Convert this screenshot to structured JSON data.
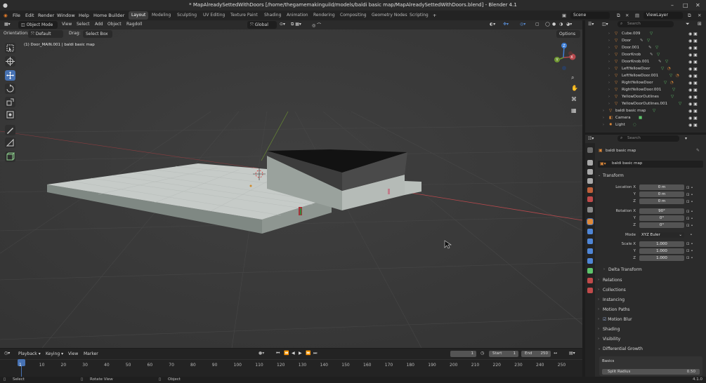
{
  "window": {
    "title": "* MapAlreadySettedWithDoors [/home/thegamemakinguild/models/baldi basic map/MapAlreadySettedWithDoors.blend] - Blender 4.1"
  },
  "menu": [
    "File",
    "Edit",
    "Render",
    "Window",
    "Help",
    "Home Builder"
  ],
  "workspaces": [
    "Layout",
    "Modeling",
    "Sculpting",
    "UV Editing",
    "Texture Paint",
    "Shading",
    "Animation",
    "Rendering",
    "Compositing",
    "Geometry Nodes",
    "Scripting"
  ],
  "active_workspace": "Layout",
  "scene": "Scene",
  "view_layer": "ViewLayer",
  "viewport": {
    "mode": "Object Mode",
    "menus": [
      "View",
      "Select",
      "Add",
      "Object",
      "Ragdoll"
    ],
    "orientation_label": "Orientation:",
    "orientation": "Default",
    "drag_label": "Drag:",
    "drag": "Select Box",
    "transform_orientation": "Global",
    "options": "Options",
    "info": "(1) Door_MAIN.001 | baldi basic map"
  },
  "outliner": {
    "search_placeholder": "Search",
    "items": [
      "Cube.009",
      "Door",
      "Door.001",
      "DoorKnob",
      "DoorKnob.001",
      "LeftYellowDoor",
      "LeftYellowDoor.001",
      "RightYellowDoor",
      "RightYellowDoor.001",
      "YellowDoorOutlines",
      "YellowDoorOutlines.001",
      "baldi basic map",
      "Camera",
      "Light"
    ]
  },
  "properties": {
    "search_placeholder": "Search",
    "object_name": "baldi basic map",
    "data_name": "baldi basic map",
    "transform_title": "Transform",
    "location_label": "Location X",
    "location": [
      "0 m",
      "0 m",
      "0 m"
    ],
    "rotation_label": "Rotation X",
    "rotation": [
      "90°",
      "0°",
      "0°"
    ],
    "mode_label": "Mode",
    "mode": "XYZ Euler",
    "scale_label": "Scale X",
    "scale": [
      "1.000",
      "1.000",
      "1.000"
    ],
    "axis_y": "Y",
    "axis_z": "Z",
    "delta_transform": "Delta Transform",
    "panels": [
      "Relations",
      "Collections",
      "Instancing",
      "Motion Paths",
      "Motion Blur",
      "Shading",
      "Visibility",
      "Differential Growth"
    ],
    "basics": "Basics",
    "split_radius_label": "Split Radius",
    "split_radius": "0.50"
  },
  "timeline": {
    "menus": [
      "Playback",
      "Keying",
      "View",
      "Marker"
    ],
    "current_frame": "1",
    "start_label": "Start",
    "start": "1",
    "end_label": "End",
    "end": "250",
    "ticks": [
      "1",
      "10",
      "20",
      "30",
      "40",
      "50",
      "60",
      "70",
      "80",
      "90",
      "100",
      "110",
      "120",
      "130",
      "140",
      "150",
      "160",
      "170",
      "180",
      "190",
      "200",
      "210",
      "220",
      "230",
      "240",
      "250"
    ]
  },
  "statusbar": {
    "select": "Select",
    "rotate_view": "Rotate View",
    "object": "Object",
    "version": "4.1.0"
  },
  "colors": {
    "accent": "#4772b3",
    "x_axis": "#b8494d",
    "y_axis": "#6f9632",
    "z_axis": "#3f7fd6",
    "active_frame": "#4772b3"
  }
}
